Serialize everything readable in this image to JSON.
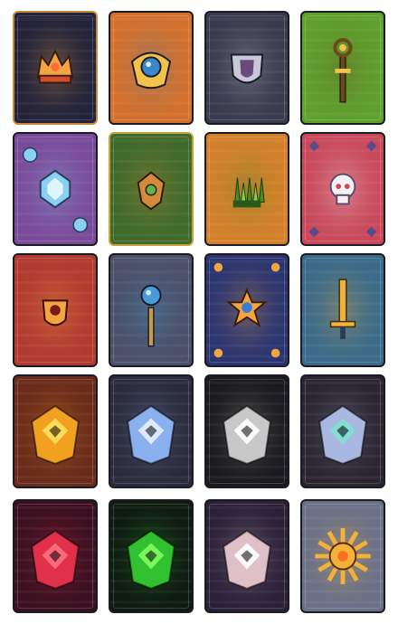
{
  "sheet": {
    "background": "#ffffff",
    "cards": [
      {
        "name": "card-dark-crown",
        "icon": "golden-crown-icon",
        "bg": "#22223a",
        "accent": "#f2a640",
        "accent2": "#d24d2a",
        "border": "#c78a3a",
        "motif": "crown"
      },
      {
        "name": "card-orange-orb",
        "icon": "blue-orb-emblem-icon",
        "bg": "#d4702b",
        "accent": "#3a86c8",
        "accent2": "#f2c24a",
        "border": "#1b1b24",
        "motif": "orb"
      },
      {
        "name": "card-slate-shield",
        "icon": "silver-shield-icon",
        "bg": "#3a3a4e",
        "accent": "#c8c8d8",
        "accent2": "#6a4a7a",
        "border": "#1b1b24",
        "motif": "shield"
      },
      {
        "name": "card-green-scepter",
        "icon": "scepter-icon",
        "bg": "#5fa02e",
        "accent": "#6a4a1a",
        "accent2": "#f2c24a",
        "border": "#1b1b24",
        "motif": "scepter"
      },
      {
        "name": "card-purple-crystal",
        "icon": "crystal-orb-icon",
        "bg": "#7a4a9a",
        "accent": "#8ad0f0",
        "accent2": "#e0f4ff",
        "border": "#1b1b24",
        "motif": "crystal"
      },
      {
        "name": "card-moss-emblem",
        "icon": "green-gem-emblem-icon",
        "bg": "#3f6a2a",
        "accent": "#d48a3a",
        "accent2": "#6ab04a",
        "border": "#c8a23a",
        "motif": "emblem"
      },
      {
        "name": "card-amber-plant",
        "icon": "leaf-plant-icon",
        "bg": "#d4802a",
        "accent": "#4a8a2a",
        "accent2": "#8ad04a",
        "border": "#1b1b24",
        "motif": "plant"
      },
      {
        "name": "card-rose-skull",
        "icon": "white-skull-emblem-icon",
        "bg": "#c8485a",
        "accent": "#f4f0f4",
        "accent2": "#5a4a8a",
        "border": "#1b1b24",
        "motif": "skull"
      },
      {
        "name": "card-red-amulet",
        "icon": "amulet-icon",
        "bg": "#b03a30",
        "accent": "#f2a640",
        "accent2": "#7a1a1a",
        "border": "#1b1b24",
        "motif": "amulet"
      },
      {
        "name": "card-steel-staff",
        "icon": "blue-orb-staff-icon",
        "bg": "#4a5068",
        "accent": "#4a9ad8",
        "accent2": "#c89a4a",
        "border": "#1b1b24",
        "motif": "staff"
      },
      {
        "name": "card-navy-sun",
        "icon": "golden-sun-shield-icon",
        "bg": "#2a3470",
        "accent": "#f2a640",
        "accent2": "#3a7ad8",
        "border": "#1b1b24",
        "motif": "sun"
      },
      {
        "name": "card-teal-sword",
        "icon": "golden-sword-icon",
        "bg": "#3a6a8a",
        "accent": "#f2b23a",
        "accent2": "#2a3a5a",
        "border": "#1b1b24",
        "motif": "sword"
      },
      {
        "name": "card-fire-badge",
        "icon": "diamond-badge-icon",
        "bg": "#6a2a1a",
        "accent": "#f2a020",
        "accent2": "#ffe060",
        "border": "#1b1b24",
        "motif": "badge"
      },
      {
        "name": "card-ice-badge",
        "icon": "diamond-badge-icon",
        "bg": "#2a2a3a",
        "accent": "#8ab0f0",
        "accent2": "#e8f0ff",
        "border": "#1b1b24",
        "motif": "badge"
      },
      {
        "name": "card-silver-badge",
        "icon": "diamond-badge-icon",
        "bg": "#1a1a1e",
        "accent": "#c8c8c8",
        "accent2": "#ffffff",
        "border": "#1b1b24",
        "motif": "badge"
      },
      {
        "name": "card-prism-badge",
        "icon": "diamond-badge-icon",
        "bg": "#2a2430",
        "accent": "#a8b8e0",
        "accent2": "#80e0d0",
        "border": "#1b1b24",
        "motif": "badge"
      },
      {
        "name": "card-crimson-badge",
        "icon": "diamond-badge-icon",
        "bg": "#3a1020",
        "accent": "#e0304a",
        "accent2": "#ff7080",
        "border": "#1b1b24",
        "motif": "badge"
      },
      {
        "name": "card-toxic-badge",
        "icon": "diamond-badge-icon",
        "bg": "#0e1a10",
        "accent": "#30c030",
        "accent2": "#80ff60",
        "border": "#1b1b24",
        "motif": "badge"
      },
      {
        "name": "card-blush-badge",
        "icon": "diamond-badge-icon",
        "bg": "#2a2038",
        "accent": "#e0c0c8",
        "accent2": "#ffffff",
        "border": "#1b1b24",
        "motif": "badge"
      },
      {
        "name": "card-gold-sunburst",
        "icon": "golden-sunburst-icon",
        "bg": "#6a7088",
        "accent": "#f2b23a",
        "accent2": "#ff7020",
        "border": "#1b1b24",
        "motif": "sunburst"
      }
    ]
  }
}
